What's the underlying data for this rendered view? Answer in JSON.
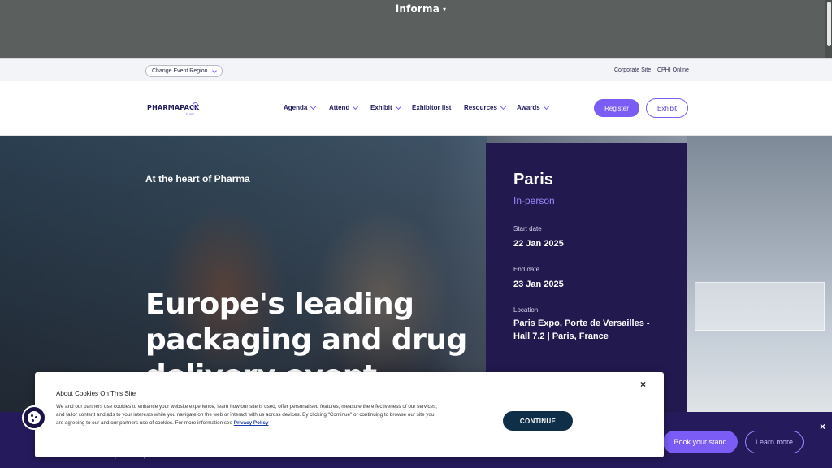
{
  "informa": {
    "logo": "informa",
    "caret": "▾"
  },
  "utility": {
    "region_button": "Change Event Region",
    "links": [
      "Corporate Site",
      "CPHI Online"
    ]
  },
  "nav": {
    "logo": "PHARMAPACK",
    "logo_sub": "by cphi",
    "items": [
      {
        "label": "Agenda",
        "dropdown": true
      },
      {
        "label": "Attend",
        "dropdown": true
      },
      {
        "label": "Exhibit",
        "dropdown": true
      },
      {
        "label": "Exhibitor list",
        "dropdown": false
      },
      {
        "label": "Resources",
        "dropdown": true
      },
      {
        "label": "Awards",
        "dropdown": true
      }
    ],
    "register_label": "Register",
    "exhibit_label": "Exhibit"
  },
  "hero": {
    "kicker": "At the heart of Pharma",
    "title": "Europe's leading packaging and drug delivery event"
  },
  "event": {
    "city": "Paris",
    "format": "In-person",
    "start_label": "Start date",
    "start_value": "22 Jan 2025",
    "end_label": "End date",
    "end_value": "23 Jan 2025",
    "location_label": "Location",
    "location_value": "Paris Expo, Porte de Versailles - Hall 7.2 | Paris, France"
  },
  "promo": {
    "text": "Join us in Paris for Pharmapack Europe 2025",
    "book_label": "Book your stand",
    "learn_label": "Learn more",
    "close": "×"
  },
  "cookies": {
    "title": "About Cookies On This Site",
    "body": "We and our partners use cookies to enhance your website experience, learn how our site is used, offer personalised features, measure the effectiveness of our services, and tailor content and ads to your interests while you navigate on the web or interact with us across devices. By clicking \"Continue\" or continuing to browse our site you are agreeing to our and our partners use of cookies. For more information see ",
    "link": "Privacy Policy",
    "continue_label": "CONTINUE",
    "close": "×"
  },
  "colors": {
    "brand_purple": "#7b5cf5",
    "card_navy": "#22194f",
    "continue_navy": "#0f2e48"
  }
}
